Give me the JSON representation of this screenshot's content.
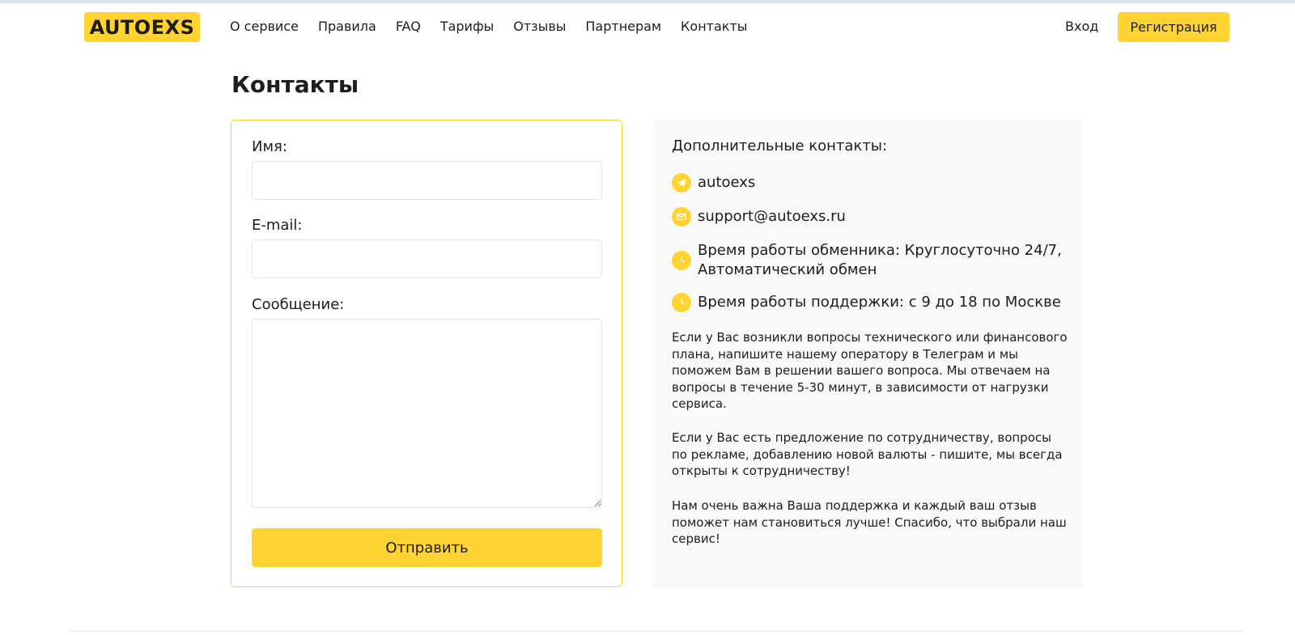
{
  "header": {
    "logo": "AUTOEXS",
    "nav": [
      "О сервисе",
      "Правила",
      "FAQ",
      "Тарифы",
      "Отзывы",
      "Партнерам",
      "Контакты"
    ],
    "login": "Вход",
    "register": "Регистрация"
  },
  "page_title": "Контакты",
  "form": {
    "name_label": "Имя:",
    "name_value": "",
    "email_label": "E-mail:",
    "email_value": "",
    "message_label": "Сообщение:",
    "message_value": "",
    "submit": "Отправить"
  },
  "info": {
    "title": "Дополнительные контакты:",
    "telegram": "autoexs",
    "email": "support@autoexs.ru",
    "exchange_hours_line1": "Время работы обменника: Круглосуточно 24/7,",
    "exchange_hours_line2": "Автоматический обмен",
    "support_hours": "Время работы поддержки: с 9 до 18 по Москве",
    "paragraph1": "Если у Вас возникли вопросы технического или финансового плана, напишите нашему оператору в Телеграм и мы поможем Вам в решении вашего вопроса. Мы отвечаем на вопросы в течение 5-30 минут, в зависимости от нагрузки сервиса.",
    "paragraph2": "Если у Вас есть предложение по сотрудничеству, вопросы по рекламе, добавлению новой валюты - пишите, мы всегда открыты к сотрудничеству!",
    "paragraph3": "Нам очень важна Ваша поддержка и каждый ваш отзыв поможет нам становиться лучше! Спасибо, что выбрали наш сервис!"
  },
  "icons": {
    "telegram": "telegram-icon",
    "email": "mail-icon",
    "clock": "clock-icon"
  },
  "colors": {
    "accent": "#ffd331",
    "panel_bg": "#f9f9f9",
    "text": "#1d1d1d"
  }
}
